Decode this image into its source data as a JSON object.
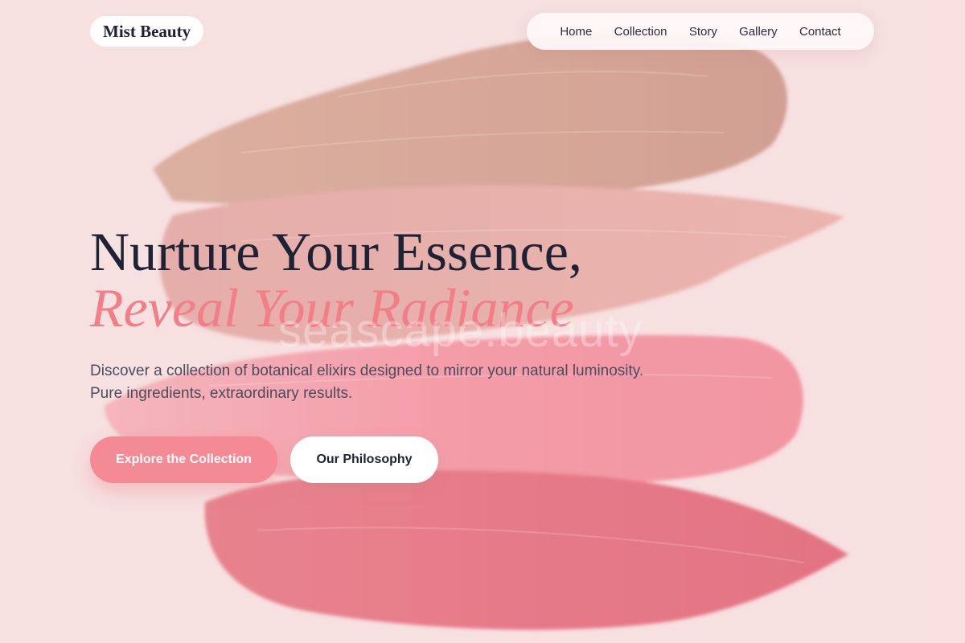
{
  "brand": {
    "name": "Mist Beauty"
  },
  "nav": {
    "items": [
      {
        "label": "Home"
      },
      {
        "label": "Collection"
      },
      {
        "label": "Story"
      },
      {
        "label": "Gallery"
      },
      {
        "label": "Contact"
      }
    ]
  },
  "hero": {
    "headline_line1": "Nurture Your Essence,",
    "headline_line2": "Reveal Your Radiance",
    "watermark": "seascape.beauty",
    "description": "Discover a collection of botanical elixirs designed to mirror your natural luminosity. Pure ingredients, extraordinary results.",
    "primary_cta": "Explore the Collection",
    "secondary_cta": "Our Philosophy"
  },
  "colors": {
    "background": "#f7dede",
    "accent": "#f48a93",
    "headline_dark": "#1e2235",
    "swatch_bronze": "#c98d78",
    "swatch_nude": "#e0958f",
    "swatch_pink": "#f27b8b",
    "swatch_red": "#e04e62"
  }
}
